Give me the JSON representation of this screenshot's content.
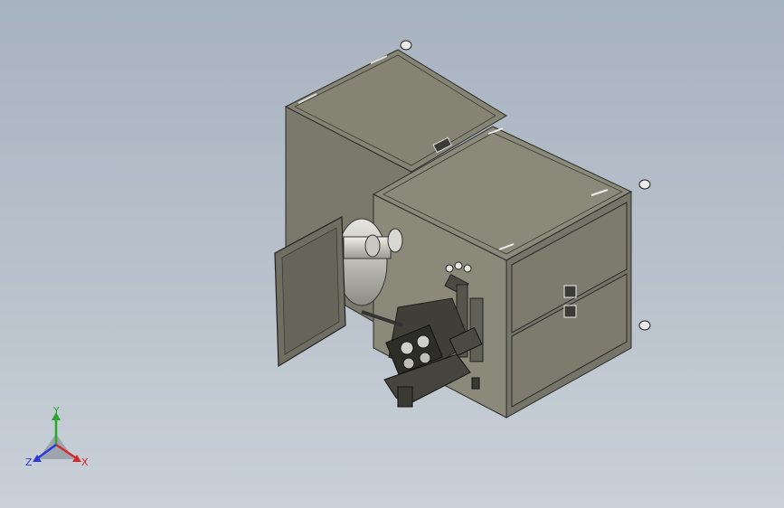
{
  "view": {
    "background_top": "#a8b3c0",
    "background_bottom": "#c9d0d8"
  },
  "model": {
    "panel_color": "#7e7d6e",
    "panel_dark": "#5f5e52",
    "panel_light": "#9a998a",
    "edge_color": "#2b2b26"
  },
  "triad": {
    "x_label": "X",
    "y_label": "Y",
    "z_label": "Z",
    "x_color": "#d42a2a",
    "y_color": "#2aa82a",
    "z_color": "#2a3ad4"
  }
}
